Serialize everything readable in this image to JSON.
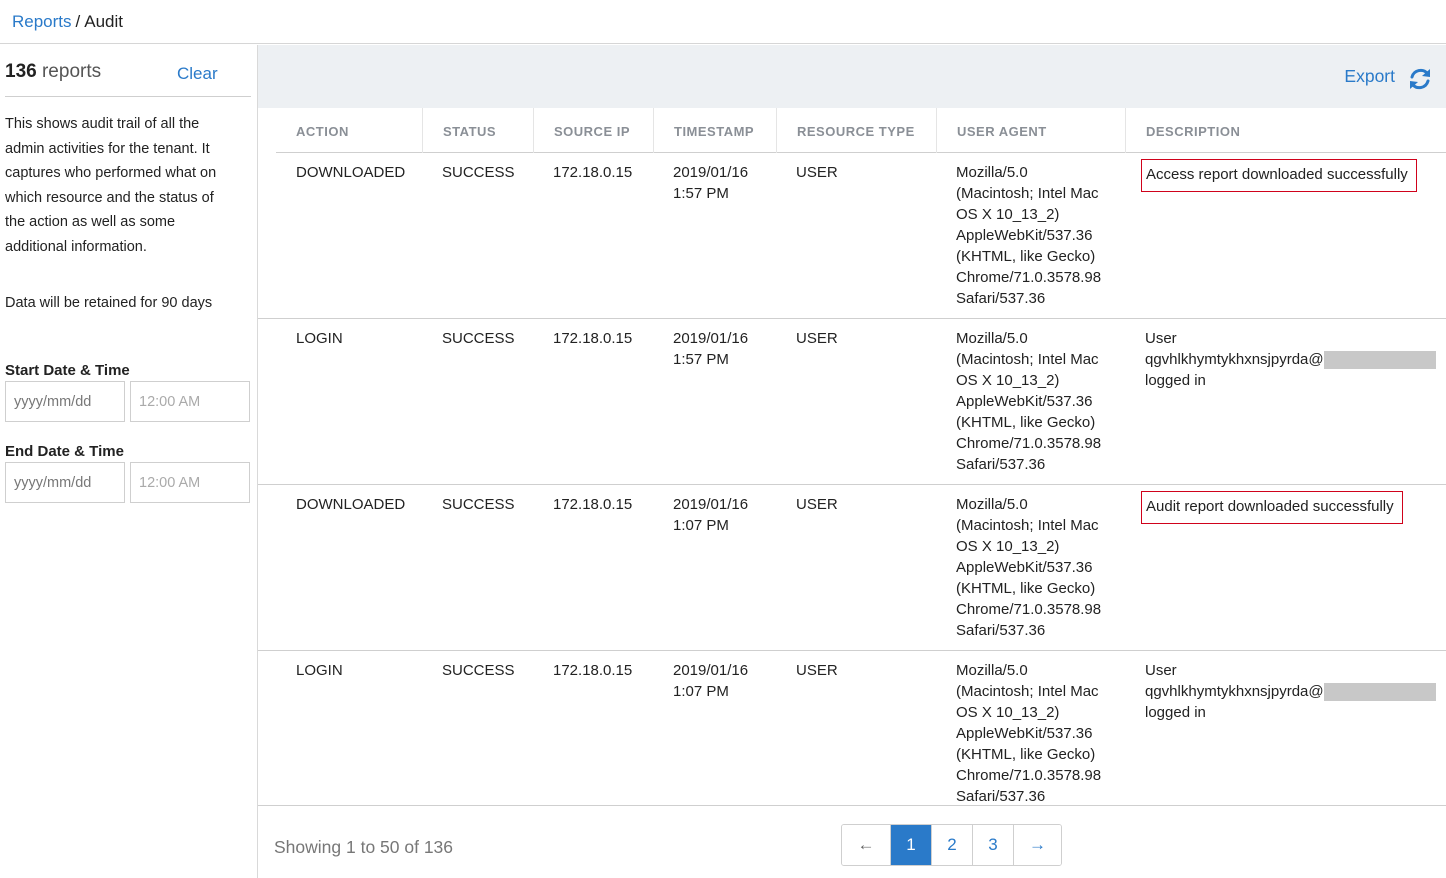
{
  "breadcrumb": {
    "link": "Reports",
    "separator": "/",
    "current": "Audit"
  },
  "sidebar": {
    "count": "136",
    "count_word": "reports",
    "clear_label": "Clear",
    "description_lines": [
      "This shows audit trail of all the",
      "admin activities for the tenant. It",
      "captures who performed what on",
      "which resource and the status of",
      "the action as well as some",
      "additional information."
    ],
    "retention": "Data will be retained for 90 days",
    "start_label": "Start Date & Time",
    "end_label": "End Date & Time",
    "date_placeholder": "yyyy/mm/dd",
    "time_placeholder": "12:00 AM"
  },
  "toolbar": {
    "export_label": "Export"
  },
  "table": {
    "columns": [
      "ACTION",
      "STATUS",
      "SOURCE IP",
      "TIMESTAMP",
      "RESOURCE TYPE",
      "USER AGENT",
      "DESCRIPTION"
    ],
    "rows": [
      {
        "action": "DOWNLOADED",
        "status": "SUCCESS",
        "ip": "172.18.0.15",
        "date": "2019/01/16",
        "time": "1:57 PM",
        "resource": "USER",
        "agent": [
          "Mozilla/5.0",
          "(Macintosh; Intel Mac",
          "OS X 10_13_2)",
          "AppleWebKit/537.36",
          "(KHTML, like Gecko)",
          "Chrome/71.0.3578.98",
          "Safari/537.36"
        ],
        "description": "Access report downloaded successfully"
      },
      {
        "action": "LOGIN",
        "status": "SUCCESS",
        "ip": "172.18.0.15",
        "date": "2019/01/16",
        "time": "1:57 PM",
        "resource": "USER",
        "agent": [
          "Mozilla/5.0",
          "(Macintosh; Intel Mac",
          "OS X 10_13_2)",
          "AppleWebKit/537.36",
          "(KHTML, like Gecko)",
          "Chrome/71.0.3578.98",
          "Safari/537.36"
        ],
        "desc_user": "User",
        "desc_email": "qgvhlkhymtykhxnsjpyrda@",
        "desc_tail": "logged in"
      },
      {
        "action": "DOWNLOADED",
        "status": "SUCCESS",
        "ip": "172.18.0.15",
        "date": "2019/01/16",
        "time": "1:07 PM",
        "resource": "USER",
        "agent": [
          "Mozilla/5.0",
          "(Macintosh; Intel Mac",
          "OS X 10_13_2)",
          "AppleWebKit/537.36",
          "(KHTML, like Gecko)",
          "Chrome/71.0.3578.98",
          "Safari/537.36"
        ],
        "description": "Audit report downloaded successfully"
      },
      {
        "action": "LOGIN",
        "status": "SUCCESS",
        "ip": "172.18.0.15",
        "date": "2019/01/16",
        "time": "1:07 PM",
        "resource": "USER",
        "agent": [
          "Mozilla/5.0",
          "(Macintosh; Intel Mac",
          "OS X 10_13_2)",
          "AppleWebKit/537.36",
          "(KHTML, like Gecko)",
          "Chrome/71.0.3578.98",
          "Safari/537.36"
        ],
        "desc_user": "User",
        "desc_email": "qgvhlkhymtykhxnsjpyrda@",
        "desc_tail": "logged in"
      }
    ]
  },
  "footer": {
    "showing": "Showing 1 to 50 of 136",
    "prev": "←",
    "pages": [
      "1",
      "2",
      "3"
    ],
    "next": "→",
    "active_page": "1"
  },
  "colors": {
    "accent": "#2a7ac9",
    "highlight_border": "#d0021b",
    "toolbar_bg": "#edf0f3"
  },
  "icons": {
    "refresh": "refresh-icon"
  }
}
